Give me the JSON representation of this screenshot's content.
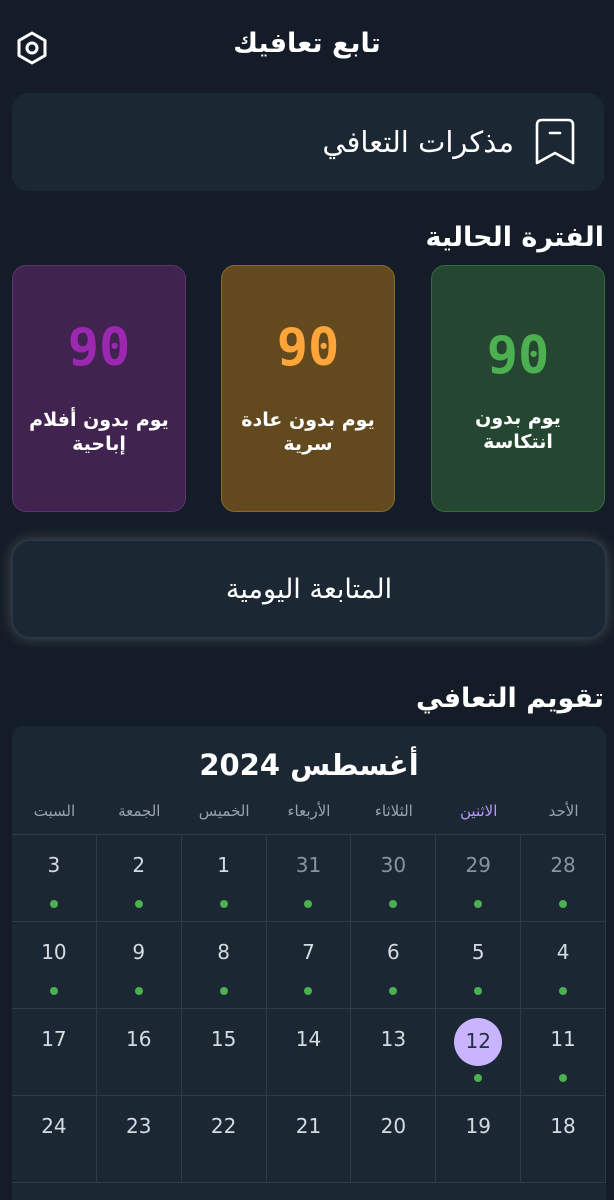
{
  "header": {
    "title": "تابع تعافيك"
  },
  "notes": {
    "label": "مذكرات التعافي"
  },
  "current_period": {
    "title": "الفترة الحالية",
    "cards": [
      {
        "id": "relapse",
        "value": "90",
        "label": "يوم بدون انتكاسة",
        "color": "#4caf50"
      },
      {
        "id": "habit",
        "value": "90",
        "label": "يوم بدون عادة سرية",
        "color": "#ffa53a"
      },
      {
        "id": "porn",
        "value": "90",
        "label": "يوم بدون أفلام إباحية",
        "color": "#9c27b0"
      }
    ]
  },
  "daily_followup": {
    "label": "المتابعة اليومية"
  },
  "calendar": {
    "title": "تقويم التعافي",
    "month_label": "أغسطس 2024",
    "weekdays": [
      "الأحد",
      "الاثنين",
      "الثلاثاء",
      "الأربعاء",
      "الخميس",
      "الجمعة",
      "السبت"
    ],
    "active_weekday_index": 1,
    "weeks": [
      [
        {
          "d": "28",
          "prev": true,
          "dot": true
        },
        {
          "d": "29",
          "prev": true,
          "dot": true
        },
        {
          "d": "30",
          "prev": true,
          "dot": true
        },
        {
          "d": "31",
          "prev": true,
          "dot": true
        },
        {
          "d": "1",
          "dot": true
        },
        {
          "d": "2",
          "dot": true
        },
        {
          "d": "3",
          "dot": true
        }
      ],
      [
        {
          "d": "4",
          "dot": true
        },
        {
          "d": "5",
          "dot": true
        },
        {
          "d": "6",
          "dot": true
        },
        {
          "d": "7",
          "dot": true
        },
        {
          "d": "8",
          "dot": true
        },
        {
          "d": "9",
          "dot": true
        },
        {
          "d": "10",
          "dot": true
        }
      ],
      [
        {
          "d": "11",
          "dot": true
        },
        {
          "d": "12",
          "dot": true,
          "today": true
        },
        {
          "d": "13"
        },
        {
          "d": "14"
        },
        {
          "d": "15"
        },
        {
          "d": "16"
        },
        {
          "d": "17"
        }
      ],
      [
        {
          "d": "18"
        },
        {
          "d": "19"
        },
        {
          "d": "20"
        },
        {
          "d": "21"
        },
        {
          "d": "22"
        },
        {
          "d": "23"
        },
        {
          "d": "24"
        }
      ]
    ],
    "colors": {
      "dot": "#4caf50",
      "today": "#c9b5ff"
    }
  }
}
